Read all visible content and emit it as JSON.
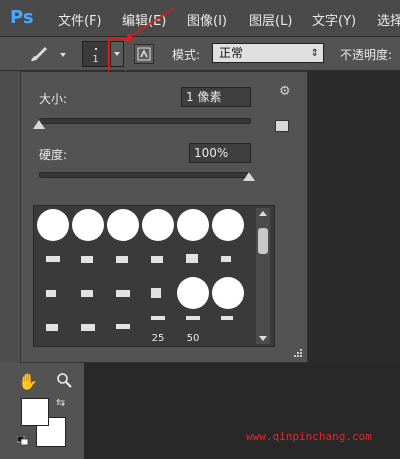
{
  "app": {
    "logo": "Ps"
  },
  "menu": [
    "文件(F)",
    "编辑(E)",
    "图像(I)",
    "图层(L)",
    "文字(Y)",
    "选择"
  ],
  "options_bar": {
    "brush_size_value": "1",
    "mode_label": "模式:",
    "mode_value": "正常",
    "opacity_label": "不透明度:"
  },
  "brush_popup": {
    "size_label": "大小:",
    "size_value": "1 像素",
    "size_slider_level": 0.0,
    "hardness_label": "硬度:",
    "hardness_value": "100%",
    "hardness_slider_level": 1.0,
    "preset_captions": [
      "25",
      "50"
    ]
  },
  "watermark": "www.qinpinchang.com",
  "colors": {
    "ps_blue": "#4aa6ff",
    "highlight_red": "#e21a1a",
    "watermark_red": "#e0282e",
    "foreground": "#ffffff",
    "background": "#ffffff"
  },
  "icons": [
    "brush-icon",
    "gear-icon",
    "new-preset-icon",
    "hand-icon",
    "zoom-icon",
    "swap-colors-icon",
    "default-colors-icon"
  ]
}
